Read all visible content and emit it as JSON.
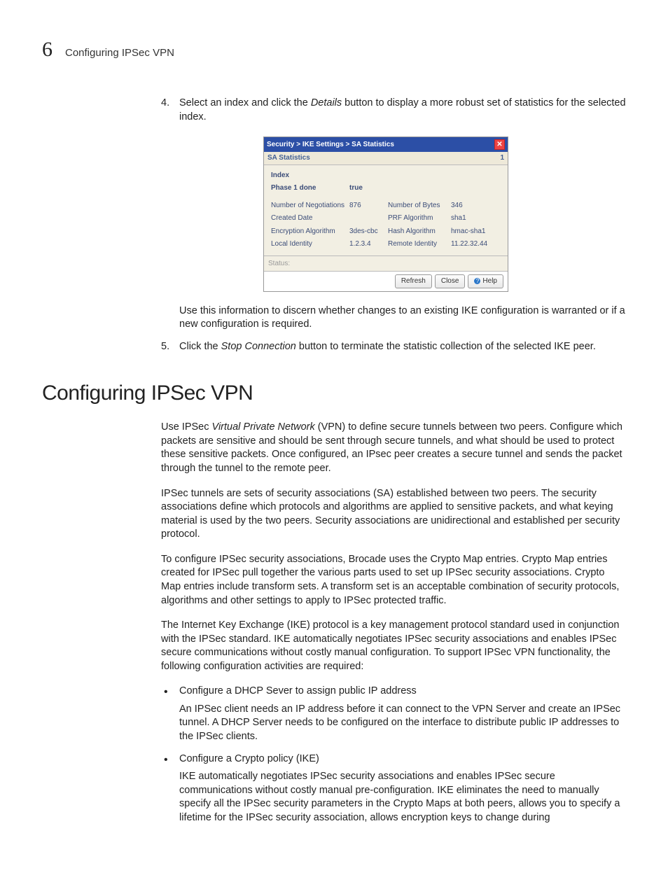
{
  "header": {
    "chapter_number": "6",
    "chapter_title": "Configuring IPSec VPN"
  },
  "step4": {
    "number": "4.",
    "text_before_button": "Select an index and click the ",
    "button_name": "Details",
    "text_after_button": " button to display a more robust set of statistics for the selected index.",
    "followup": "Use this information to discern whether changes to an existing IKE configuration is warranted or if a new configuration is required."
  },
  "dialog": {
    "breadcrumb": "Security > IKE Settings > SA Statistics",
    "subheading": "SA Statistics",
    "subheading_count": "1",
    "index_label": "Index",
    "phase1_label": "Phase 1 done",
    "phase1_value": "true",
    "rows": [
      {
        "l": "Number of Negotiations",
        "v": "876",
        "l2": "Number of Bytes",
        "v2": "346"
      },
      {
        "l": "Created Date",
        "v": "",
        "l2": "PRF Algorithm",
        "v2": "sha1"
      },
      {
        "l": "Encryption Algorithm",
        "v": "3des-cbc",
        "l2": "Hash Algorithm",
        "v2": "hmac-sha1"
      },
      {
        "l": "Local Identity",
        "v": "1.2.3.4",
        "l2": "Remote Identity",
        "v2": "11.22.32.44"
      }
    ],
    "status_label": "Status:",
    "buttons": {
      "refresh": "Refresh",
      "close": "Close",
      "help": "Help"
    }
  },
  "step5": {
    "number": "5.",
    "text_before_button": "Click the ",
    "button_name": "Stop Connection",
    "text_after_button": " button to terminate the statistic collection of the selected IKE peer."
  },
  "section": {
    "title": "Configuring IPSec VPN",
    "p1_before": "Use IPSec ",
    "p1_italic": "Virtual Private Network",
    "p1_after": " (VPN) to define secure tunnels between two peers. Configure which packets are sensitive and should be sent through secure tunnels, and what should be used to protect these sensitive packets. Once configured, an IPsec peer creates a secure tunnel and sends the packet through the tunnel to the remote peer.",
    "p2": "IPSec tunnels are sets of security associations (SA) established between two peers. The security associations define which protocols and algorithms are applied to sensitive packets, and what keying material is used by the two peers. Security associations are unidirectional and established per security protocol.",
    "p3": "To configure IPSec security associations, Brocade uses the Crypto Map entries. Crypto Map entries created for IPSec pull together the various parts used to set up IPSec security associations. Crypto Map entries include transform sets. A transform set is an acceptable combination of security protocols, algorithms and other settings to apply to IPSec protected traffic.",
    "p4": "The Internet Key Exchange (IKE) protocol is a key management protocol standard used in conjunction with the IPSec standard. IKE automatically negotiates IPSec security associations and enables IPSec secure communications without costly manual configuration. To support IPSec VPN functionality, the following configuration activities are required:",
    "b1_title": "Configure a DHCP Sever to assign public IP address",
    "b1_body": "An IPSec client needs an IP address before it can connect to the VPN Server and create an IPSec tunnel. A DHCP Server needs to be configured on the interface to distribute public IP addresses to the IPSec clients.",
    "b2_title": "Configure a Crypto policy (IKE)",
    "b2_body": "IKE automatically negotiates IPSec security associations and enables IPSec secure communications without costly manual pre-configuration. IKE eliminates the need to manually specify all the IPSec security parameters in the Crypto Maps at both peers, allows you to specify a lifetime for the IPSec security association, allows encryption keys to change during"
  }
}
